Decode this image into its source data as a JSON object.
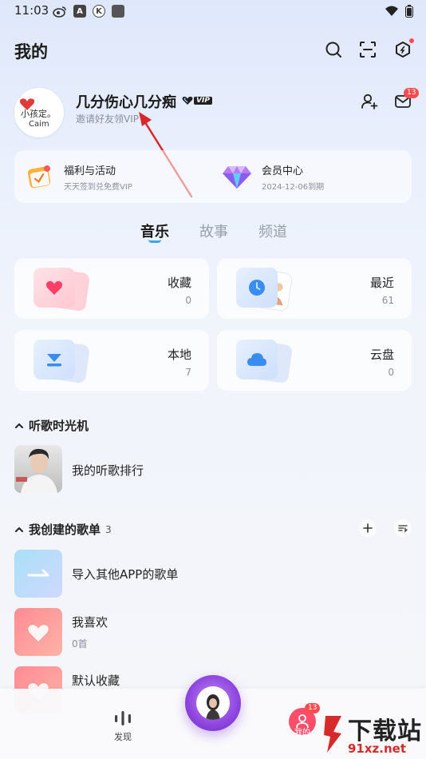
{
  "status_bar": {
    "time": "11:03"
  },
  "header": {
    "title": "我的"
  },
  "profile": {
    "name": "几分伤心几分痴",
    "vip_badge": "VIP",
    "subtitle": "邀请好友领VIP",
    "avatar_text_line1": "小孩定。",
    "avatar_text_line2": "Caim",
    "notification_count": "13"
  },
  "benefits": [
    {
      "title": "福利与活动",
      "subtitle": "天天签到兑免费VIP",
      "icon": "calendar-gift-icon"
    },
    {
      "title": "会员中心",
      "subtitle": "2024-12-06到期",
      "icon": "diamond-icon"
    }
  ],
  "tabs": [
    {
      "label": "音乐",
      "active": true
    },
    {
      "label": "故事",
      "active": false
    },
    {
      "label": "频道",
      "active": false
    }
  ],
  "library": [
    {
      "label": "收藏",
      "count": "0",
      "icon": "heart-icon",
      "color": "#ff5f7a"
    },
    {
      "label": "最近",
      "count": "61",
      "icon": "clock-icon",
      "color": "#3a8df0"
    },
    {
      "label": "本地",
      "count": "7",
      "icon": "download-icon",
      "color": "#3a8df0"
    },
    {
      "label": "云盘",
      "count": "0",
      "icon": "cloud-icon",
      "color": "#3a8df0"
    }
  ],
  "time_machine": {
    "heading": "听歌时光机",
    "item_title": "我的听歌排行"
  },
  "playlists": {
    "heading": "我创建的歌单",
    "count": "3",
    "items": [
      {
        "title": "导入其他APP的歌单",
        "subtitle": ""
      },
      {
        "title": "我喜欢",
        "subtitle": "0首"
      },
      {
        "title": "默认收藏",
        "subtitle": ""
      }
    ]
  },
  "bottom_nav": {
    "discover_label": "发现",
    "mine_label": "我的",
    "mine_badge": "13"
  },
  "watermark": {
    "main": "下载站",
    "url": "91xz.net"
  }
}
